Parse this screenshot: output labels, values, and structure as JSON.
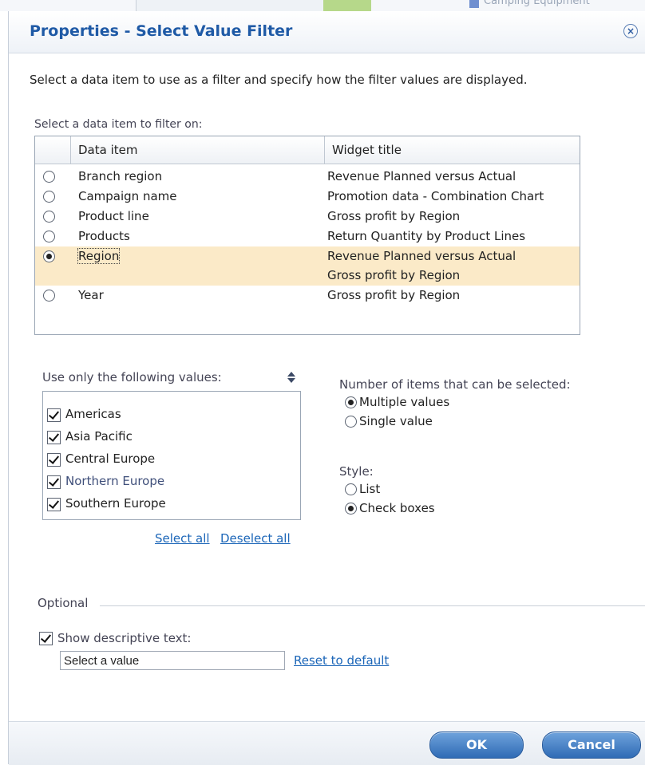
{
  "background": {
    "partial_text": "Camping Equipment"
  },
  "dialog": {
    "title": "Properties - Select Value Filter",
    "close_symbol": "×",
    "intro": "Select a data item to use as a filter and specify how the filter values are displayed.",
    "table_label": "Select a data item to filter on:",
    "table": {
      "columns": [
        "Data item",
        "Widget title"
      ],
      "rows": [
        {
          "item": "Branch region",
          "titles": [
            "Revenue Planned versus Actual"
          ],
          "selected": false
        },
        {
          "item": "Campaign name",
          "titles": [
            "Promotion data - Combination Chart"
          ],
          "selected": false
        },
        {
          "item": "Product line",
          "titles": [
            "Gross profit by Region"
          ],
          "selected": false
        },
        {
          "item": "Products",
          "titles": [
            "Return Quantity by Product Lines"
          ],
          "selected": false
        },
        {
          "item": "Region",
          "titles": [
            "Revenue Planned versus Actual",
            "Gross profit by Region"
          ],
          "selected": true
        },
        {
          "item": "Year",
          "titles": [
            "Gross profit by Region"
          ],
          "selected": false
        }
      ]
    },
    "values": {
      "label": "Use only the following values:",
      "items": [
        {
          "label": "Americas",
          "checked": true
        },
        {
          "label": "Asia Pacific",
          "checked": true
        },
        {
          "label": "Central Europe",
          "checked": true
        },
        {
          "label": "Northern Europe",
          "checked": true
        },
        {
          "label": "Southern Europe",
          "checked": true
        }
      ],
      "select_all": "Select all",
      "deselect_all": "Deselect all"
    },
    "selection_count": {
      "label": "Number of items that can be selected:",
      "options": [
        {
          "label": "Multiple values",
          "selected": true
        },
        {
          "label": "Single value",
          "selected": false
        }
      ]
    },
    "style": {
      "label": "Style:",
      "options": [
        {
          "label": "List",
          "selected": false
        },
        {
          "label": "Check boxes",
          "selected": true
        }
      ]
    },
    "optional": {
      "label": "Optional",
      "show_descriptive_text": {
        "label": "Show descriptive text:",
        "checked": true
      },
      "text_value": "Select a value",
      "reset": "Reset to default"
    },
    "buttons": {
      "ok": "OK",
      "cancel": "Cancel"
    }
  }
}
